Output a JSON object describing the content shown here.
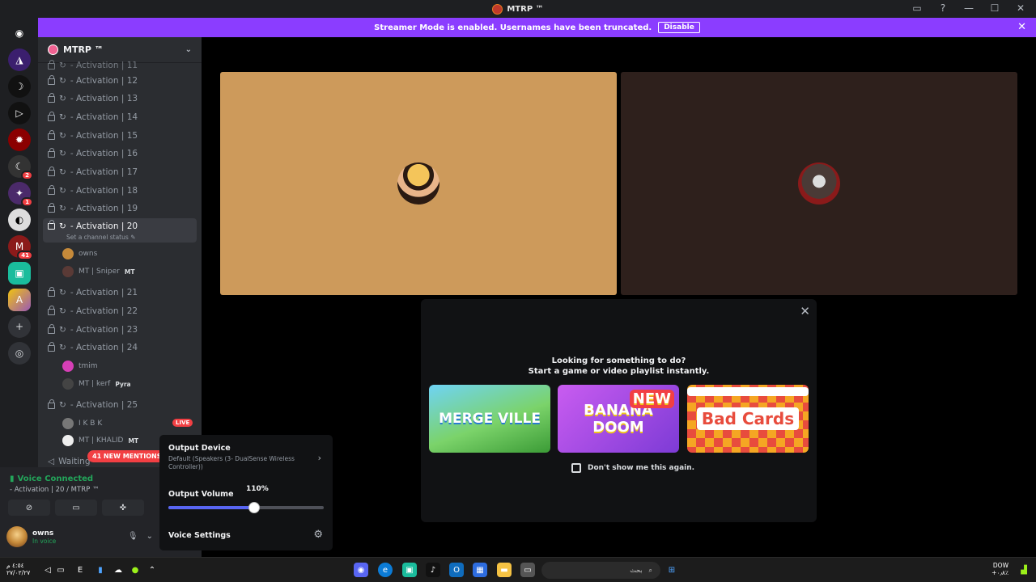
{
  "window": {
    "title": "MTRP ™"
  },
  "banner": {
    "text": "Streamer Mode is enabled. Usernames have been truncated.",
    "disable_label": "Disable"
  },
  "guild": {
    "name": "MTRP ™"
  },
  "channels": {
    "c11": "- Activation | 11",
    "c12": "- Activation | 12",
    "c13": "- Activation | 13",
    "c14": "- Activation | 14",
    "c15": "- Activation | 15",
    "c16": "- Activation | 16",
    "c17": "- Activation | 17",
    "c18": "- Activation | 18",
    "c19": "- Activation | 19",
    "c20": "- Activation | 20",
    "c20_status": "Set a channel status",
    "c21": "- Activation | 21",
    "c22": "- Activation | 22",
    "c23": "- Activation | 23",
    "c24": "- Activation | 24",
    "c25": "- Activation | 25",
    "next": "Waiting"
  },
  "members": {
    "m1": "owns",
    "m2": "MT | Sniper",
    "m2_tag": "MT",
    "m3": "tmim",
    "m4": "MT | kerf",
    "m4_tag": "Pyra",
    "m5": "I K B K",
    "m6": "MT | KHALID",
    "m6_tag": "MT"
  },
  "live_label": "LIVE",
  "mentions_label": "41 NEW MENTIONS",
  "servers": {
    "b1": "2",
    "b2": "1",
    "b3": "41"
  },
  "voice": {
    "title": "Voice Connected",
    "channel": "- Activation | 20 / MTRP ™"
  },
  "user": {
    "name": "owns",
    "status": "In voice"
  },
  "popup": {
    "title1": "Looking for something to do?",
    "title2": "Start a game or video playlist instantly.",
    "game1": "MERGE VILLE",
    "game2": "BANANA DOOM",
    "game2_badge": "NEW",
    "game3": "Bad Cards",
    "game3_top": "PLAY AT YOUR OWN RISK",
    "dont_show": "Don't show me this again."
  },
  "output": {
    "device_label": "Output Device",
    "device_value": "Default (Speakers (3- DualSense Wireless Controller))",
    "volume_label": "Output Volume",
    "volume_pct": "110%",
    "volume_fraction": 0.55,
    "voice_settings": "Voice Settings"
  },
  "taskbar": {
    "time": "٤:٥٤ م",
    "date": "٢٧/٠٢/٢٧",
    "search_placeholder": "بحث",
    "market": "DOW",
    "market_val": "+٠٫٨٪"
  }
}
